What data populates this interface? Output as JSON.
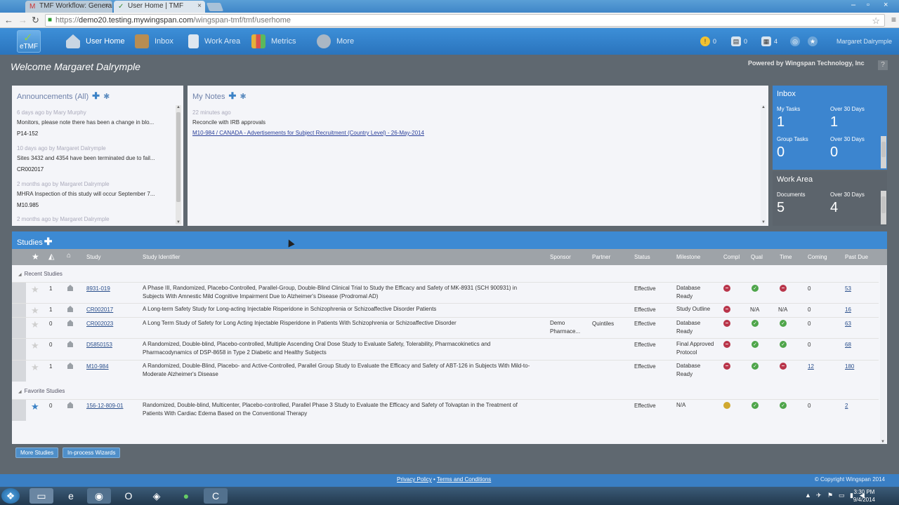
{
  "browser": {
    "tabs": [
      {
        "label": "TMF Workflow: General T",
        "icon": "gmail-icon"
      },
      {
        "label": "User Home | TMF",
        "icon": "tmf-favicon"
      }
    ],
    "url_prefix": "https://",
    "url_host": "demo20.testing.mywingspan.com",
    "url_path": "/wingspan-tmf/tmf/userhome"
  },
  "header": {
    "logo_text": "eTMF",
    "nav": [
      {
        "label": "User Home",
        "icon": "house-icon"
      },
      {
        "label": "Inbox",
        "icon": "inbox-icon"
      },
      {
        "label": "Work Area",
        "icon": "document-icon"
      },
      {
        "label": "Metrics",
        "icon": "bar-chart-icon"
      },
      {
        "label": "More",
        "icon": "gear-icon"
      }
    ],
    "badges": [
      {
        "icon": "alert-icon",
        "count": "0",
        "color": "#f1c232"
      },
      {
        "icon": "task-icon",
        "count": "0",
        "color": "#d8e4ef"
      },
      {
        "icon": "clipboard-icon",
        "count": "4",
        "color": "#d8e4ef"
      }
    ],
    "username": "Margaret Dalrymple"
  },
  "welcome": "Welcome Margaret Dalrymple",
  "powered_by": "Powered by Wingspan Technology, Inc",
  "help": "?",
  "announcements": {
    "title": "Announcements (All)",
    "items": [
      {
        "meta": "6 days ago by Mary Murphy",
        "msg": "Monitors, please note there has been a change in blo...",
        "code": "P14-152"
      },
      {
        "meta": "10 days ago by Margaret Dalrymple",
        "msg": "Sites 3432 and 4354 have been terminated due to fail...",
        "code": "CR002017"
      },
      {
        "meta": "2 months ago by Margaret Dalrymple",
        "msg": "MHRA Inspection of this study will occur September 7...",
        "code": "M10.985"
      },
      {
        "meta": "2 months ago by Margaret Dalrymple",
        "msg": "",
        "code": ""
      }
    ]
  },
  "notes": {
    "title": "My Notes",
    "meta": "22 minutes ago",
    "text": "Reconcile with IRB approvals",
    "link": "M10-984 / CANADA - Advertisements for Subject Recruitment (Country Level) - 26-May-2014"
  },
  "inbox": {
    "title": "Inbox",
    "my_tasks_label": "My Tasks",
    "my_tasks": "1",
    "my_over_label": "Over 30 Days",
    "my_over": "1",
    "group_label": "Group Tasks",
    "group": "0",
    "group_over_label": "Over 30 Days",
    "group_over": "0"
  },
  "workarea": {
    "title": "Work Area",
    "docs_label": "Documents",
    "docs": "5",
    "over_label": "Over 30 Days",
    "over": "4"
  },
  "studies": {
    "title": "Studies",
    "columns": [
      "Study",
      "Study Identifier",
      "Sponsor",
      "Partner",
      "Status",
      "Milestone",
      "Compl",
      "Qual",
      "Time",
      "Coming",
      "Past Due"
    ],
    "groups": {
      "recent": "Recent Studies",
      "favorite": "Favorite Studies"
    },
    "recent": [
      {
        "n": "1",
        "study": "8931-019",
        "id1": "A Phase III, Randomized, Placebo-Controlled, Parallel-Group, Double-Blind Clinical Trial to Study the Efficacy and Safety of MK-8931 (SCH 900931) in",
        "id2": "Subjects With Amnestic Mild Cognitive Impairment Due to Alzheimer's Disease (Prodromal AD)",
        "sponsor1": "",
        "sponsor2": "",
        "partner": "",
        "status": "Effective",
        "ms1": "Database",
        "ms2": "Ready",
        "compl": "red",
        "qual": "green",
        "time": "red",
        "coming": "0",
        "pastdue": "53",
        "fav": false
      },
      {
        "n": "1",
        "study": "CR002017",
        "id1": "A Long-term Safety Study for Long-acting Injectable Risperidone in Schizophrenia or Schizoaffective Disorder Patients",
        "id2": "",
        "sponsor1": "",
        "sponsor2": "",
        "partner": "",
        "status": "Effective",
        "ms1": "Study Outline",
        "ms2": "",
        "compl": "red",
        "qual": "N/A",
        "time": "N/A",
        "coming": "0",
        "pastdue": "16",
        "fav": false
      },
      {
        "n": "0",
        "study": "CR002023",
        "id1": "A Long Term Study of Safety for Long Acting Injectable Risperidone in Patients With Schizophrenia or Schizoaffective Disorder",
        "id2": "",
        "sponsor1": "Demo",
        "sponsor2": "Pharmace...",
        "partner": "Quintiles",
        "status": "Effective",
        "ms1": "Database",
        "ms2": "Ready",
        "compl": "red",
        "qual": "green",
        "time": "green",
        "coming": "0",
        "pastdue": "63",
        "fav": false
      },
      {
        "n": "0",
        "study": "D5850153",
        "id1": "A Randomized, Double-blind, Placebo-controlled, Multiple Ascending Oral Dose Study to Evaluate Safety, Tolerability, Pharmacokinetics and",
        "id2": "Pharmacodynamics of DSP-8658 in Type 2 Diabetic and Healthy Subjects",
        "sponsor1": "",
        "sponsor2": "",
        "partner": "",
        "status": "Effective",
        "ms1": "Final Approved",
        "ms2": "Protocol",
        "compl": "red",
        "qual": "green",
        "time": "green",
        "coming": "0",
        "pastdue": "68",
        "fav": false
      },
      {
        "n": "1",
        "study": "M10-984",
        "id1": "A Randomized, Double-Blind, Placebo- and Active-Controlled, Parallel Group Study to Evaluate the Efficacy and Safety of ABT-126 in Subjects With Mild-to-",
        "id2": "Moderate Alzheimer's Disease",
        "sponsor1": "",
        "sponsor2": "",
        "partner": "",
        "status": "Effective",
        "ms1": "Database",
        "ms2": "Ready",
        "compl": "red",
        "qual": "green",
        "time": "red",
        "coming": "12",
        "pastdue": "180",
        "fav": false
      }
    ],
    "favorite": [
      {
        "n": "0",
        "study": "156-12-809-01",
        "id1": "Randomized, Double-blind, Multicenter, Placebo-controlled, Parallel Phase 3 Study to Evaluate the Efficacy and Safety of Tolvaptan in the Treatment of",
        "id2": "Patients With Cardiac Edema Based on the Conventional Therapy",
        "sponsor1": "",
        "sponsor2": "",
        "partner": "",
        "status": "Effective",
        "ms1": "N/A",
        "ms2": "",
        "compl": "yellow",
        "qual": "green",
        "time": "green",
        "coming": "0",
        "pastdue": "2",
        "fav": true
      }
    ]
  },
  "buttons": {
    "more": "More Studies",
    "wizards": "In-process Wizards"
  },
  "footer": {
    "privacy": "Privacy Policy",
    "sep": " • ",
    "terms": "Terms and Conditions",
    "copyright": "© Copyright Wingspan 2014"
  },
  "taskbar": {
    "time": "3:30 PM",
    "date": "9/4/2014"
  }
}
